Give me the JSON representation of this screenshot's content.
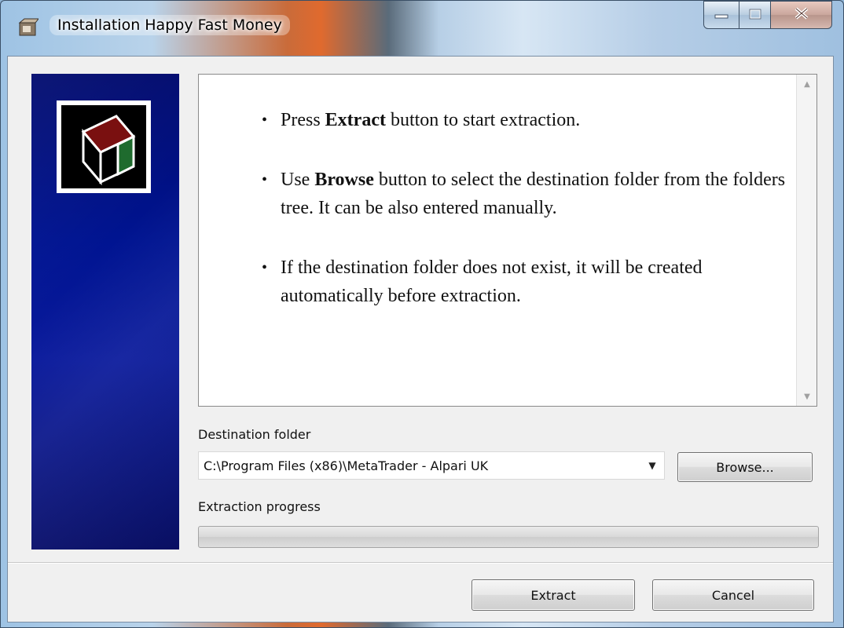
{
  "window": {
    "title": "Installation Happy Fast Money"
  },
  "info": {
    "bullets": [
      {
        "pre": "Press ",
        "bold": "Extract",
        "post": " button to start extraction."
      },
      {
        "pre": "Use ",
        "bold": "Browse",
        "post": " button to select the destination folder from the folders tree. It can be also entered manually."
      },
      {
        "pre": "",
        "bold": "",
        "post": "If the destination folder does not exist, it will be created automatically before extraction."
      }
    ]
  },
  "destination": {
    "label": "Destination folder",
    "value": "C:\\Program Files (x86)\\MetaTrader - Alpari UK",
    "browse_label": "Browse..."
  },
  "progress": {
    "label": "Extraction progress",
    "fraction": 0
  },
  "footer": {
    "extract_label": "Extract",
    "cancel_label": "Cancel"
  },
  "colors": {
    "side_panel": "#001491",
    "logo_red": "#7a1010",
    "logo_green": "#1f6b2e"
  },
  "icons": {
    "title": "installer-app-icon",
    "minimize": "minimize-icon",
    "maximize": "maximize-icon",
    "close": "close-icon",
    "logo": "package-box-icon"
  }
}
